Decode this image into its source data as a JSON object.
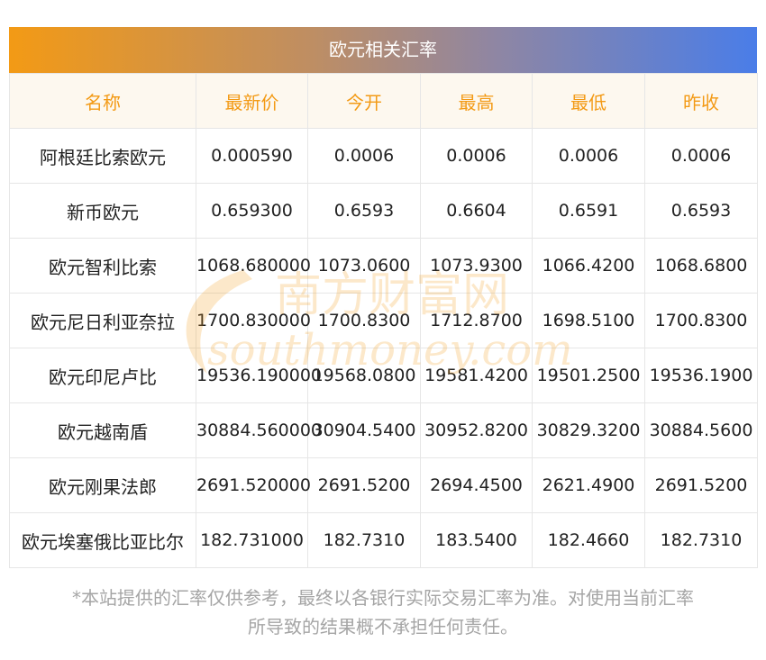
{
  "title": "欧元相关汇率",
  "columns": [
    "名称",
    "最新价",
    "今开",
    "最高",
    "最低",
    "昨收"
  ],
  "rows": [
    [
      "阿根廷比索欧元",
      "0.000590",
      "0.0006",
      "0.0006",
      "0.0006",
      "0.0006"
    ],
    [
      "新币欧元",
      "0.659300",
      "0.6593",
      "0.6604",
      "0.6591",
      "0.6593"
    ],
    [
      "欧元智利比索",
      "1068.680000",
      "1073.0600",
      "1073.9300",
      "1066.4200",
      "1068.6800"
    ],
    [
      "欧元尼日利亚奈拉",
      "1700.830000",
      "1700.8300",
      "1712.8700",
      "1698.5100",
      "1700.8300"
    ],
    [
      "欧元印尼卢比",
      "19536.190000",
      "19568.0800",
      "19581.4200",
      "19501.2500",
      "19536.1900"
    ],
    [
      "欧元越南盾",
      "30884.560000",
      "30904.5400",
      "30952.8200",
      "30829.3200",
      "30884.5600"
    ],
    [
      "欧元刚果法郎",
      "2691.520000",
      "2691.5200",
      "2694.4500",
      "2621.4900",
      "2691.5200"
    ],
    [
      "欧元埃塞俄比亚比尔",
      "182.731000",
      "182.7310",
      "183.5400",
      "182.4660",
      "182.7310"
    ]
  ],
  "watermark": {
    "cn": "南方财富网",
    "en": "southmoney.com"
  },
  "footnote": {
    "line1": "*本站提供的汇率仅供参考，最终以各银行实际交易汇率为准。对使用当前汇率",
    "line2": "所导致的结果概不承担任何责任。"
  },
  "colors": {
    "accent": "#f39a15",
    "gradient_end": "#4a7de8",
    "header_bg": "#fdf8ef",
    "note": "#a5a5a5"
  }
}
